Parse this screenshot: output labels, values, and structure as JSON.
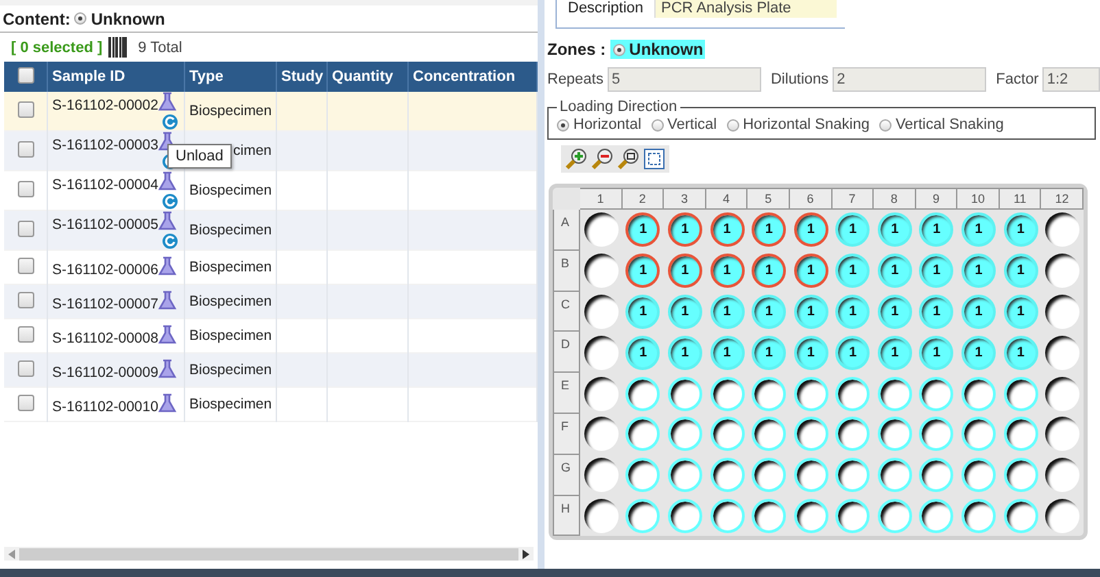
{
  "samples_panel": {
    "content_filter": {
      "label": "Content:",
      "option": "Unknown",
      "selected": true
    },
    "summary": {
      "selected_count": "[ 0 selected ]",
      "total": "9 Total"
    },
    "table": {
      "columns": [
        "Sample ID",
        "Type",
        "Study",
        "Quantity",
        "Concentration"
      ],
      "header_checked": false,
      "rows": [
        {
          "sample_id": "S-161102-00002",
          "type": "Biospecimen",
          "checked": false,
          "hovered": true,
          "loaded": true
        },
        {
          "sample_id": "S-161102-00003",
          "type": "cimen",
          "checked": false,
          "hovered": false,
          "loaded": true
        },
        {
          "sample_id": "S-161102-00004",
          "type": "Biospecimen",
          "checked": false,
          "hovered": false,
          "loaded": true
        },
        {
          "sample_id": "S-161102-00005",
          "type": "Biospecimen",
          "checked": false,
          "hovered": false,
          "loaded": true
        },
        {
          "sample_id": "S-161102-00006",
          "type": "Biospecimen",
          "checked": false,
          "hovered": false,
          "loaded": false
        },
        {
          "sample_id": "S-161102-00007",
          "type": "Biospecimen",
          "checked": false,
          "hovered": false,
          "loaded": false
        },
        {
          "sample_id": "S-161102-00008",
          "type": "Biospecimen",
          "checked": false,
          "hovered": false,
          "loaded": false
        },
        {
          "sample_id": "S-161102-00009",
          "type": "Biospecimen",
          "checked": false,
          "hovered": false,
          "loaded": false
        },
        {
          "sample_id": "S-161102-00010",
          "type": "Biospecimen",
          "checked": false,
          "hovered": false,
          "loaded": false
        }
      ]
    },
    "tooltip": "Unload"
  },
  "plate_panel": {
    "description": {
      "label": "Description",
      "value": "PCR Analysis Plate"
    },
    "zones": {
      "label": "Zones :",
      "option": "Unknown",
      "selected": true
    },
    "fields": [
      {
        "label": "Repeats",
        "value": "5"
      },
      {
        "label": "Dilutions",
        "value": "2"
      },
      {
        "label": "Factor",
        "value": "1:2"
      }
    ],
    "loading_direction": {
      "legend": "Loading Direction",
      "options": [
        {
          "label": "Horizontal",
          "selected": true
        },
        {
          "label": "Vertical",
          "selected": false
        },
        {
          "label": "Horizontal Snaking",
          "selected": false
        },
        {
          "label": "Vertical Snaking",
          "selected": false
        }
      ]
    },
    "toolbar": [
      {
        "kind": "zoom_in"
      },
      {
        "kind": "zoom_out"
      },
      {
        "kind": "zoom_reset"
      },
      {
        "kind": "fit"
      }
    ],
    "plate": {
      "columns": [
        "1",
        "2",
        "3",
        "4",
        "5",
        "6",
        "7",
        "8",
        "9",
        "10",
        "11",
        "12"
      ],
      "rows": [
        {
          "label": "A",
          "wells": [
            {
              "kind": "blank",
              "selected": false
            },
            {
              "kind": "filled",
              "text": "1",
              "selected": true
            },
            {
              "kind": "filled",
              "text": "1",
              "selected": true
            },
            {
              "kind": "filled",
              "text": "1",
              "selected": true
            },
            {
              "kind": "filled",
              "text": "1",
              "selected": true
            },
            {
              "kind": "filled",
              "text": "1",
              "selected": true
            },
            {
              "kind": "filled",
              "text": "1",
              "selected": false
            },
            {
              "kind": "filled",
              "text": "1",
              "selected": false
            },
            {
              "kind": "filled",
              "text": "1",
              "selected": false
            },
            {
              "kind": "filled",
              "text": "1",
              "selected": false
            },
            {
              "kind": "filled",
              "text": "1",
              "selected": false
            },
            {
              "kind": "blank",
              "selected": false
            }
          ]
        },
        {
          "label": "B",
          "wells": [
            {
              "kind": "blank",
              "selected": false
            },
            {
              "kind": "filled",
              "text": "1",
              "selected": true
            },
            {
              "kind": "filled",
              "text": "1",
              "selected": true
            },
            {
              "kind": "filled",
              "text": "1",
              "selected": true
            },
            {
              "kind": "filled",
              "text": "1",
              "selected": true
            },
            {
              "kind": "filled",
              "text": "1",
              "selected": true
            },
            {
              "kind": "filled",
              "text": "1",
              "selected": false
            },
            {
              "kind": "filled",
              "text": "1",
              "selected": false
            },
            {
              "kind": "filled",
              "text": "1",
              "selected": false
            },
            {
              "kind": "filled",
              "text": "1",
              "selected": false
            },
            {
              "kind": "filled",
              "text": "1",
              "selected": false
            },
            {
              "kind": "blank",
              "selected": false
            }
          ]
        },
        {
          "label": "C",
          "wells": [
            {
              "kind": "blank",
              "selected": false
            },
            {
              "kind": "filled",
              "text": "1",
              "selected": false
            },
            {
              "kind": "filled",
              "text": "1",
              "selected": false
            },
            {
              "kind": "filled",
              "text": "1",
              "selected": false
            },
            {
              "kind": "filled",
              "text": "1",
              "selected": false
            },
            {
              "kind": "filled",
              "text": "1",
              "selected": false
            },
            {
              "kind": "filled",
              "text": "1",
              "selected": false
            },
            {
              "kind": "filled",
              "text": "1",
              "selected": false
            },
            {
              "kind": "filled",
              "text": "1",
              "selected": false
            },
            {
              "kind": "filled",
              "text": "1",
              "selected": false
            },
            {
              "kind": "filled",
              "text": "1",
              "selected": false
            },
            {
              "kind": "blank",
              "selected": false
            }
          ]
        },
        {
          "label": "D",
          "wells": [
            {
              "kind": "blank",
              "selected": false
            },
            {
              "kind": "filled",
              "text": "1",
              "selected": false
            },
            {
              "kind": "filled",
              "text": "1",
              "selected": false
            },
            {
              "kind": "filled",
              "text": "1",
              "selected": false
            },
            {
              "kind": "filled",
              "text": "1",
              "selected": false
            },
            {
              "kind": "filled",
              "text": "1",
              "selected": false
            },
            {
              "kind": "filled",
              "text": "1",
              "selected": false
            },
            {
              "kind": "filled",
              "text": "1",
              "selected": false
            },
            {
              "kind": "filled",
              "text": "1",
              "selected": false
            },
            {
              "kind": "filled",
              "text": "1",
              "selected": false
            },
            {
              "kind": "filled",
              "text": "1",
              "selected": false
            },
            {
              "kind": "blank",
              "selected": false
            }
          ]
        },
        {
          "label": "E",
          "wells": [
            {
              "kind": "blank",
              "selected": false
            },
            {
              "kind": "zone",
              "selected": false
            },
            {
              "kind": "zone",
              "selected": false
            },
            {
              "kind": "zone",
              "selected": false
            },
            {
              "kind": "zone",
              "selected": false
            },
            {
              "kind": "zone",
              "selected": false
            },
            {
              "kind": "zone",
              "selected": false
            },
            {
              "kind": "zone",
              "selected": false
            },
            {
              "kind": "zone",
              "selected": false
            },
            {
              "kind": "zone",
              "selected": false
            },
            {
              "kind": "zone",
              "selected": false
            },
            {
              "kind": "blank",
              "selected": false
            }
          ]
        },
        {
          "label": "F",
          "wells": [
            {
              "kind": "blank",
              "selected": false
            },
            {
              "kind": "zone",
              "selected": false
            },
            {
              "kind": "zone",
              "selected": false
            },
            {
              "kind": "zone",
              "selected": false
            },
            {
              "kind": "zone",
              "selected": false
            },
            {
              "kind": "zone",
              "selected": false
            },
            {
              "kind": "zone",
              "selected": false
            },
            {
              "kind": "zone",
              "selected": false
            },
            {
              "kind": "zone",
              "selected": false
            },
            {
              "kind": "zone",
              "selected": false
            },
            {
              "kind": "zone",
              "selected": false
            },
            {
              "kind": "blank",
              "selected": false
            }
          ]
        },
        {
          "label": "G",
          "wells": [
            {
              "kind": "blank",
              "selected": false
            },
            {
              "kind": "zone",
              "selected": false
            },
            {
              "kind": "zone",
              "selected": false
            },
            {
              "kind": "zone",
              "selected": false
            },
            {
              "kind": "zone",
              "selected": false
            },
            {
              "kind": "zone",
              "selected": false
            },
            {
              "kind": "zone",
              "selected": false
            },
            {
              "kind": "zone",
              "selected": false
            },
            {
              "kind": "zone",
              "selected": false
            },
            {
              "kind": "zone",
              "selected": false
            },
            {
              "kind": "zone",
              "selected": false
            },
            {
              "kind": "blank",
              "selected": false
            }
          ]
        },
        {
          "label": "H",
          "wells": [
            {
              "kind": "blank",
              "selected": false
            },
            {
              "kind": "zone",
              "selected": false
            },
            {
              "kind": "zone",
              "selected": false
            },
            {
              "kind": "zone",
              "selected": false
            },
            {
              "kind": "zone",
              "selected": false
            },
            {
              "kind": "zone",
              "selected": false
            },
            {
              "kind": "zone",
              "selected": false
            },
            {
              "kind": "zone",
              "selected": false
            },
            {
              "kind": "zone",
              "selected": false
            },
            {
              "kind": "zone",
              "selected": false
            },
            {
              "kind": "zone",
              "selected": false
            },
            {
              "kind": "blank",
              "selected": false
            }
          ]
        }
      ]
    }
  }
}
